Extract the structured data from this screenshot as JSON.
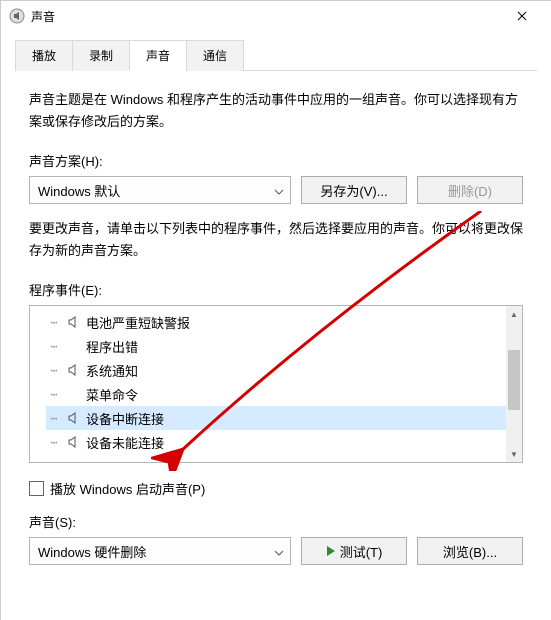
{
  "window": {
    "title": "声音"
  },
  "tabs": {
    "playback": "播放",
    "record": "录制",
    "sound": "声音",
    "comm": "通信"
  },
  "desc1": "声音主题是在 Windows 和程序产生的活动事件中应用的一组声音。你可以选择现有方案或保存修改后的方案。",
  "scheme": {
    "label": "声音方案(H):",
    "value": "Windows 默认"
  },
  "buttons": {
    "saveAs": "另存为(V)...",
    "delete": "删除(D)",
    "test": "测试(T)",
    "browse": "浏览(B)..."
  },
  "desc2": "要更改声音，请单击以下列表中的程序事件，然后选择要应用的声音。你可以将更改保存为新的声音方案。",
  "events": {
    "label": "程序事件(E):",
    "items": [
      {
        "hasSound": true,
        "label": "电池严重短缺警报"
      },
      {
        "hasSound": false,
        "label": "程序出错"
      },
      {
        "hasSound": true,
        "label": "系统通知"
      },
      {
        "hasSound": false,
        "label": "菜单命令"
      },
      {
        "hasSound": true,
        "label": "设备中断连接",
        "selected": true
      },
      {
        "hasSound": true,
        "label": "设备未能连接"
      }
    ]
  },
  "checkbox": {
    "startup": "播放 Windows 启动声音(P)"
  },
  "sound": {
    "label": "声音(S):",
    "value": "Windows 硬件删除"
  }
}
